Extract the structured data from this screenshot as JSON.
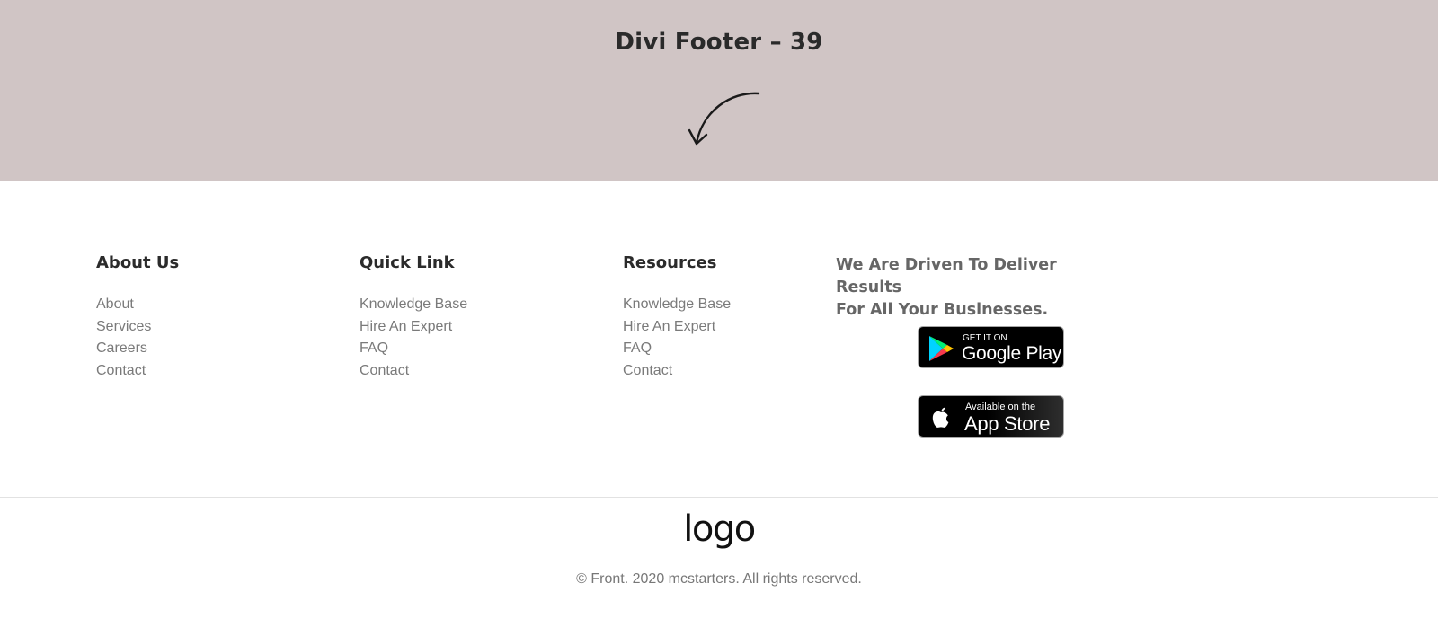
{
  "hero": {
    "title": "Divi Footer – 39",
    "background": "#d0c5c5",
    "icon": "curved-arrow-down-left-icon"
  },
  "columns": [
    {
      "title": "About Us",
      "links": [
        "About",
        "Services",
        "Careers",
        "Contact"
      ]
    },
    {
      "title": "Quick Link",
      "links": [
        "Knowledge Base",
        "Hire An Expert",
        "FAQ",
        "Contact"
      ]
    },
    {
      "title": "Resources",
      "links": [
        "Knowledge Base",
        "Hire An Expert",
        "FAQ",
        "Contact"
      ]
    }
  ],
  "promo": {
    "tagline_line1": "We Are Driven To Deliver Results",
    "tagline_line2": "For All Your Businesses.",
    "google_play": {
      "small": "GET IT ON",
      "big": "Google Play",
      "icon": "google-play-icon"
    },
    "app_store": {
      "small": "Available on the",
      "big": "App Store",
      "icon": "apple-icon"
    }
  },
  "bottom": {
    "logo": "logo",
    "copyright": "© Front. 2020 mcstarters. All rights reserved."
  }
}
